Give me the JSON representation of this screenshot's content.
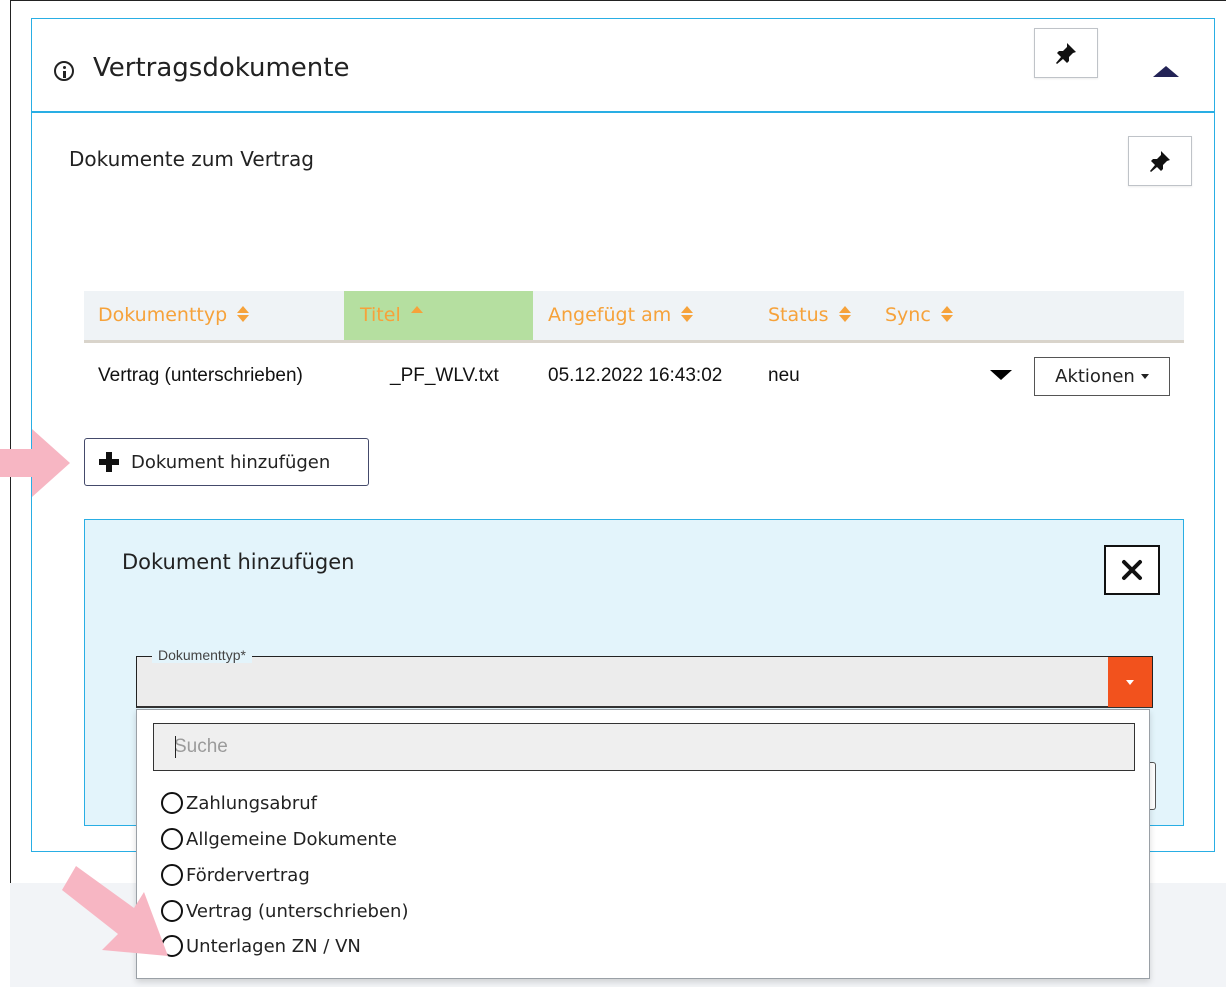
{
  "panel": {
    "title": "Vertragsdokumente",
    "section_title": "Dokumente zum Vertrag"
  },
  "table": {
    "columns": [
      {
        "label": "Dokumenttyp",
        "sort": "both"
      },
      {
        "label": "Titel",
        "sort": "asc"
      },
      {
        "label": "Angefügt am",
        "sort": "both"
      },
      {
        "label": "Status",
        "sort": "both"
      },
      {
        "label": "Sync",
        "sort": "both"
      }
    ],
    "rows": [
      {
        "dokumenttyp": "Vertrag (unterschrieben)",
        "titel": "_PF_WLV.txt",
        "angefuegt": "05.12.2022 16:43:02",
        "status": "neu",
        "actions_label": "Aktionen"
      }
    ]
  },
  "add_button_label": "Dokument hinzufügen",
  "add_panel": {
    "title": "Dokument hinzufügen",
    "select_label": "Dokumenttyp*",
    "search_placeholder": "Suche",
    "options": [
      "Zahlungsabruf",
      "Allgemeine Dokumente",
      "Fördervertrag",
      "Vertrag (unterschrieben)",
      "Unterlagen ZN / VN"
    ]
  },
  "colors": {
    "accent_blue": "#29aee4",
    "header_orange": "#f6a23a",
    "sorted_column_green": "#b5dfa0",
    "select_toggle": "#f2521d",
    "annotation_arrow": "#f7b6c3",
    "collapse_arrow": "#232356"
  }
}
